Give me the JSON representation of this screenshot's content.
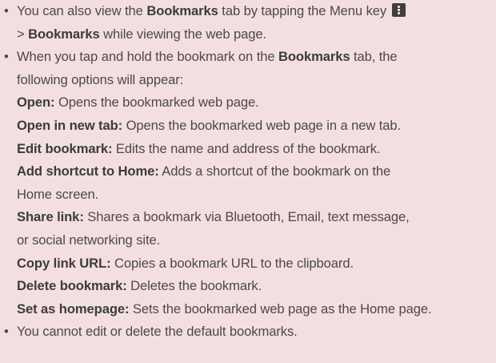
{
  "bullet_char": "•",
  "bullets": [
    {
      "line1_pre": "You can also view the ",
      "line1_bold": "Bookmarks",
      "line1_post": " tab by tapping the Menu key ",
      "line2_pre": "> ",
      "line2_bold": "Bookmarks",
      "line2_post": " while viewing the web page."
    },
    {
      "line1_pre": "When you tap and hold the bookmark on the ",
      "line1_bold": "Bookmarks",
      "line1_post": " tab, the",
      "line2": "following options will appear:"
    },
    {
      "text": "You cannot edit or delete the default bookmarks."
    }
  ],
  "options": [
    {
      "name": "Open:",
      "desc": " Opens the bookmarked web page."
    },
    {
      "name": "Open in new tab:",
      "desc": " Opens the bookmarked web page in a new tab."
    },
    {
      "name": "Edit bookmark:",
      "desc": " Edits the name and address of the bookmark."
    },
    {
      "name": "Add shortcut to Home:",
      "desc": " Adds a shortcut of the bookmark on the",
      "desc_line2": "Home screen."
    },
    {
      "name": "Share link:",
      "desc": " Shares a bookmark via Bluetooth, Email, text message,",
      "desc_line2": "or social networking site."
    },
    {
      "name": "Copy link URL:",
      "desc": " Copies a bookmark URL to the clipboard."
    },
    {
      "name": "Delete bookmark:",
      "desc": " Deletes the bookmark."
    },
    {
      "name": "Set as homepage:",
      "desc": " Sets the bookmarked web page as the Home page."
    }
  ],
  "icons": {
    "menu_key": "menu-key-icon"
  },
  "colors": {
    "background": "#f4dfe0",
    "text": "#4a4a4a",
    "icon": "#3e3e3e"
  }
}
